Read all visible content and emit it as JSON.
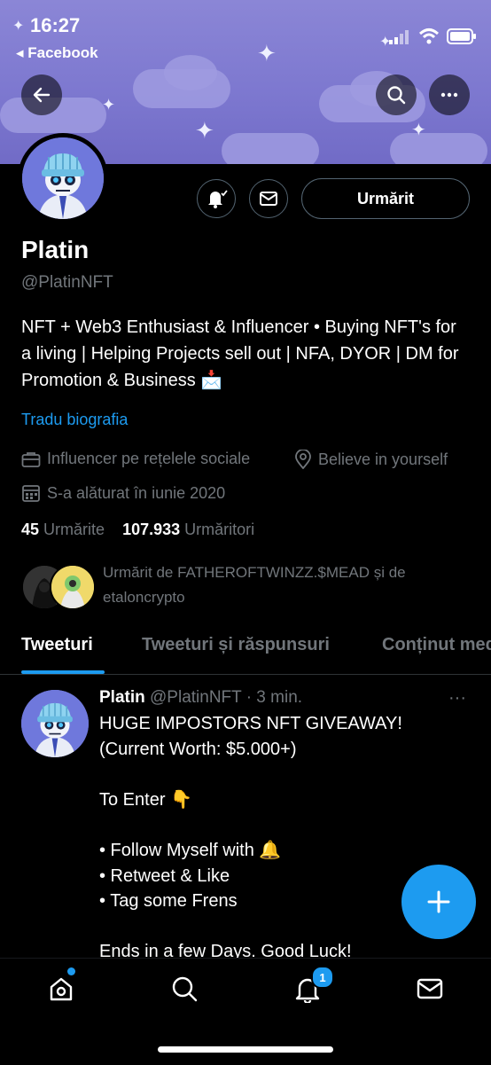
{
  "status_bar": {
    "time": "16:27",
    "back_app": "◂ Facebook"
  },
  "profile": {
    "name": "Platin",
    "handle": "@PlatinNFT",
    "bio": "NFT + Web3 Enthusiast & Influencer • Buying NFT's for a living | Helping Projects sell out | NFA, DYOR | DM for Promotion & Business 📩",
    "translate_link": "Tradu biografia",
    "category": "Influencer pe rețelele sociale",
    "location": "Believe in yourself",
    "joined": "S-a alăturat în iunie 2020",
    "following_count": "45",
    "following_label": "Urmărite",
    "followers_count": "107.933",
    "followers_label": "Urmăritori",
    "followed_by": "Urmărit de FATHEROFTWINZZ.$MEAD și de etaloncrypto",
    "follow_button": "Urmărit"
  },
  "tabs": [
    "Tweeturi",
    "Tweeturi și răspunsuri",
    "Conținut media"
  ],
  "tweet": {
    "name": "Platin",
    "handle": "@PlatinNFT",
    "time": "· 3 min.",
    "more": "···",
    "text": "HUGE IMPOSTORS NFT GIVEAWAY!\n(Current Worth: $5.000+)\n\nTo Enter 👇\n\n• Follow Myself with 🔔\n• Retweet & Like\n• Tag some Frens\n\nEnds in a few Days. Good Luck!"
  },
  "bottom_nav": {
    "notifications_badge": "1"
  },
  "colors": {
    "accent": "#1d9bf0",
    "banner": "#7c77cf",
    "background": "#000000",
    "muted": "#71767b"
  },
  "icons": [
    "back-arrow-icon",
    "search-icon",
    "more-icon",
    "bell-subscribe-icon",
    "mail-icon",
    "briefcase-icon",
    "location-icon",
    "calendar-icon",
    "plus-icon",
    "home-icon",
    "search-icon",
    "bell-icon",
    "mail-icon"
  ]
}
